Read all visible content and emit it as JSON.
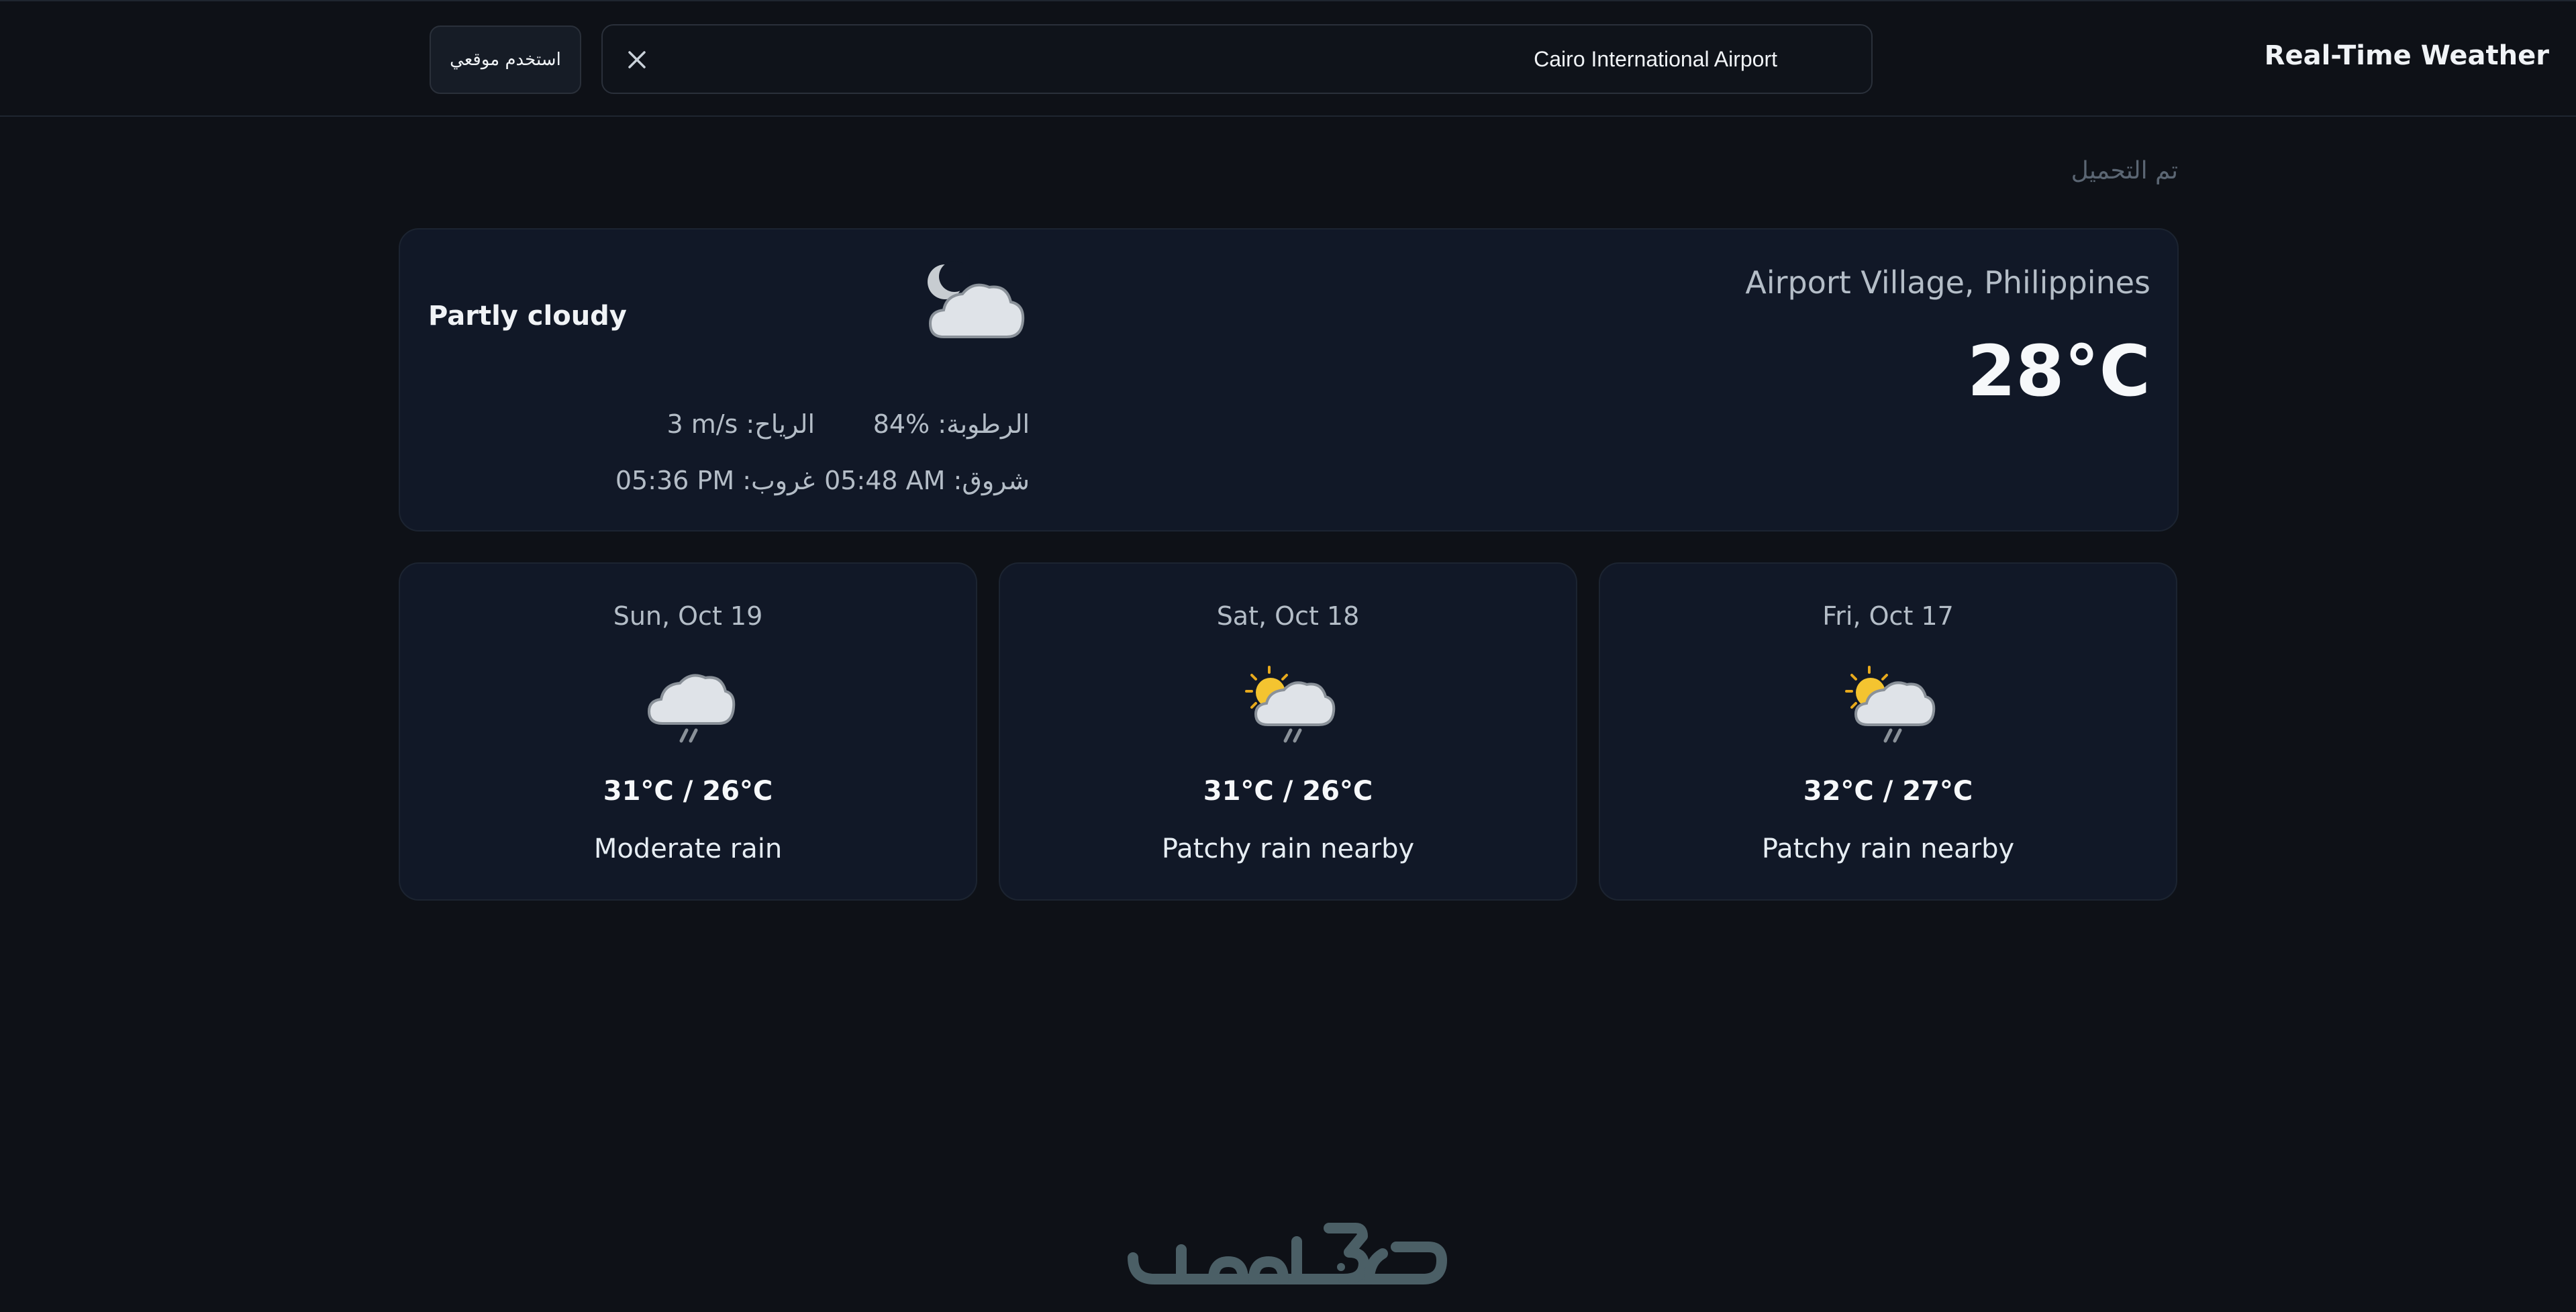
{
  "header": {
    "title": "Real-Time Weather",
    "search_value": "Cairo International Airport",
    "locate_label": "استخدم موقعي"
  },
  "status": "تم التحميل",
  "current": {
    "location": "Airport Village, Philippines",
    "temperature": "28°C",
    "condition": "Partly cloudy",
    "icon": "partly-cloudy-night-icon",
    "humidity_label": "الرطوبة:",
    "humidity_value": "84%",
    "wind_label": "الرياح:",
    "wind_value": "3 m/s",
    "sunrise_label": "شروق:",
    "sunrise_value": "05:48 AM",
    "sunset_label": "غروب:",
    "sunset_value": "05:36 PM"
  },
  "forecast": [
    {
      "date": "Sun, Oct 19",
      "temps": "31°C / 26°C",
      "condition": "Moderate rain",
      "icon": "rain-cloud-icon"
    },
    {
      "date": "Sat, Oct 18",
      "temps": "31°C / 26°C",
      "condition": "Patchy rain nearby",
      "icon": "sun-cloud-rain-icon"
    },
    {
      "date": "Fri, Oct 17",
      "temps": "32°C / 27°C",
      "condition": "Patchy rain nearby",
      "icon": "sun-cloud-rain-icon"
    }
  ],
  "footer": {
    "logo_text": "خمسات",
    "accent": "#4b5f66"
  }
}
